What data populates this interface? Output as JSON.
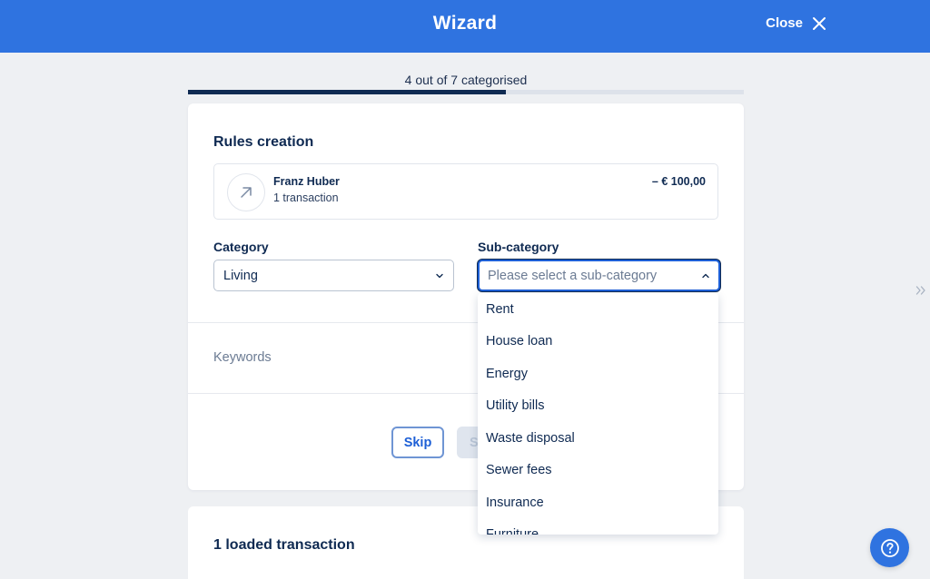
{
  "header": {
    "title": "Wizard",
    "close_label": "Close"
  },
  "progress": {
    "label": "4 out of 7 categorised",
    "done": 4,
    "total": 7
  },
  "rules": {
    "title": "Rules creation",
    "transaction": {
      "name": "Franz Huber",
      "count": "1 transaction",
      "amount": "– € 100,00",
      "icon": "arrow-up-right-icon"
    }
  },
  "category": {
    "label": "Category",
    "value": "Living"
  },
  "subcategory": {
    "label": "Sub-category",
    "placeholder": "Please select a sub-category",
    "options": [
      "Rent",
      "House loan",
      "Energy",
      "Utility bills",
      "Waste disposal",
      "Sewer fees",
      "Insurance",
      "Furniture"
    ]
  },
  "keywords": {
    "label": "Keywords"
  },
  "actions": {
    "skip_label": "Skip",
    "save_label": "Save"
  },
  "loaded": {
    "title": "1 loaded transaction"
  },
  "colors": {
    "header": "#2f73e0",
    "navy": "#0f2a52",
    "accent": "#1d5fd6"
  }
}
